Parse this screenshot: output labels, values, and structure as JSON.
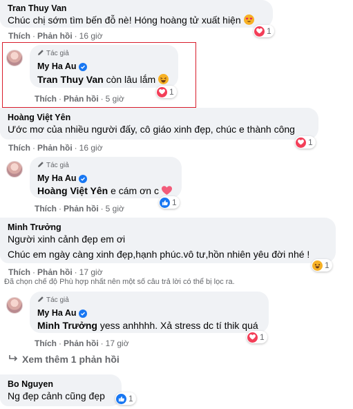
{
  "comments": [
    {
      "author": "Tran Thuy Van",
      "text": "Chúc chị sớm tìm bến đỗ nè! Hóng hoàng tử xuất hiện",
      "like_label": "Thích",
      "reply_label": "Phản hồi",
      "time": "16 giờ",
      "reaction": {
        "icon": "love",
        "count": "1"
      }
    },
    {
      "author_tag": "Tác giả",
      "author": "My Ha Au",
      "mention": "Tran Thuy Van",
      "text": "còn lâu lắm",
      "like_label": "Thích",
      "reply_label": "Phản hồi",
      "time": "5 giờ",
      "reaction": {
        "icon": "love",
        "count": "1"
      }
    },
    {
      "author": "Hoàng Việt Yên",
      "text": "Ước mơ của nhiều người đấy, cô giáo xinh đẹp, chúc e thành công",
      "like_label": "Thích",
      "reply_label": "Phản hồi",
      "time": "16 giờ",
      "reaction": {
        "icon": "love",
        "count": "1"
      }
    },
    {
      "author_tag": "Tác giả",
      "author": "My Ha Au",
      "mention": "Hoàng Việt Yên",
      "text": "e cám ơn c",
      "like_label": "Thích",
      "reply_label": "Phản hồi",
      "time": "5 giờ",
      "reaction": {
        "icon": "like",
        "count": "1"
      }
    },
    {
      "author": "Minh Trưởng",
      "text_line1": "Người xinh cảnh đẹp em ơi",
      "text_line2": "Chúc em ngày càng xinh đẹp,hạnh phúc.vô tư,hồn nhiên yêu đời nhé !",
      "like_label": "Thích",
      "reply_label": "Phản hồi",
      "time": "17 giờ",
      "reaction": {
        "icon": "haha",
        "count": "1"
      }
    },
    {
      "author_tag": "Tác giả",
      "author": "My Ha Au",
      "mention": "Minh Trưởng",
      "text": "yess anhhhh. Xả stress dc tí thik quá",
      "like_label": "Thích",
      "reply_label": "Phản hồi",
      "time": "17 giờ",
      "reaction": {
        "icon": "love",
        "count": "1"
      }
    },
    {
      "author": "Bo Nguyen",
      "text": "Ng đẹp cảnh cũng đẹp",
      "reaction": {
        "icon": "like",
        "count": "1"
      }
    }
  ],
  "filter_notice": "Đã chọn chế độ Phù hợp nhất nên một số câu trả lời có thể bị lọc ra.",
  "view_more_replies": "Xem thêm 1 phản hồi",
  "separator": "·",
  "colors": {
    "highlight": "#d81b2a",
    "bubble": "#f0f2f5",
    "link": "#65676b",
    "like": "#1877f2",
    "love": "#f33e58"
  }
}
